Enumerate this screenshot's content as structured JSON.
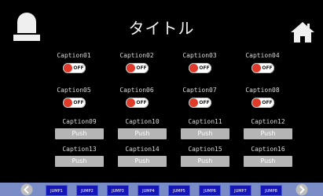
{
  "header": {
    "title": "タイトル",
    "alarm_icon": "alarm-lamp-icon",
    "home_icon": "home-icon"
  },
  "toggles": [
    {
      "caption": "Caption01",
      "state": "OFF"
    },
    {
      "caption": "Caption02",
      "state": "OFF"
    },
    {
      "caption": "Caption03",
      "state": "OFF"
    },
    {
      "caption": "Caption04",
      "state": "OFF"
    },
    {
      "caption": "Caption05",
      "state": "OFF"
    },
    {
      "caption": "Caption06",
      "state": "OFF"
    },
    {
      "caption": "Caption07",
      "state": "OFF"
    },
    {
      "caption": "Caption08",
      "state": "OFF"
    }
  ],
  "push_buttons": [
    {
      "caption": "Caption09",
      "label": "Push"
    },
    {
      "caption": "Caption10",
      "label": "Push"
    },
    {
      "caption": "Caption11",
      "label": "Push"
    },
    {
      "caption": "Caption12",
      "label": "Push"
    },
    {
      "caption": "Caption13",
      "label": "Push"
    },
    {
      "caption": "Caption14",
      "label": "Push"
    },
    {
      "caption": "Caption15",
      "label": "Push"
    },
    {
      "caption": "Caption16",
      "label": "Push"
    }
  ],
  "footer": {
    "prev_icon": "chevron-left-icon",
    "next_icon": "chevron-right-icon",
    "jumps": [
      "JUMP1",
      "JUMP2",
      "JUMP3",
      "JUMP4",
      "JUMP5",
      "JUMP6",
      "JUMP7",
      "JUMP8"
    ]
  },
  "colors": {
    "background": "#000000",
    "toggle_off": "#e03a2a",
    "push_button": "#b5b5b5",
    "footer_bar": "#7a8cc6",
    "jump_button": "#1515b8"
  }
}
